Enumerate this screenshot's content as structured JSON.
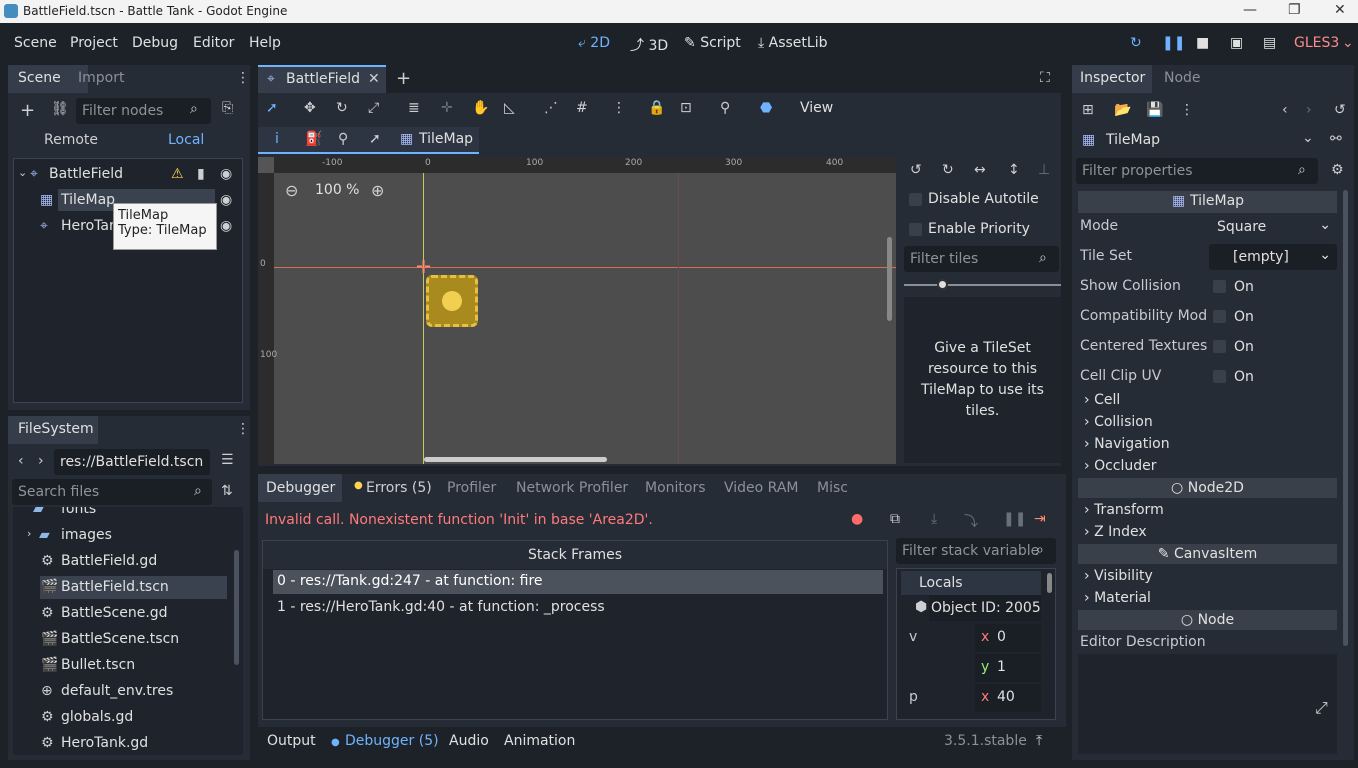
{
  "window": {
    "title": "BattleField.tscn - Battle Tank - Godot Engine",
    "controls": {
      "minimize": "—",
      "maximize": "❐",
      "close": "✕"
    }
  },
  "menu": {
    "items": [
      "Scene",
      "Project",
      "Debug",
      "Editor",
      "Help"
    ]
  },
  "workspaces": {
    "items": [
      "2D",
      "3D",
      "Script",
      "AssetLib"
    ],
    "active": "2D"
  },
  "run": {
    "renderer": "GLES3"
  },
  "scene_dock": {
    "tabs": [
      "Scene",
      "Import"
    ],
    "filter_placeholder": "Filter nodes",
    "remote": "Remote",
    "local": "Local",
    "tree": [
      {
        "name": "BattleField",
        "icon": "node2d-icon"
      },
      {
        "name": "TileMap",
        "icon": "tilemap-icon"
      },
      {
        "name": "HeroTank",
        "icon": "node2d-icon"
      }
    ],
    "tooltip": {
      "line1": "TileMap",
      "line2": "Type: TileMap"
    }
  },
  "filesystem": {
    "title": "FileSystem",
    "path": "res://BattleField.tscn",
    "search_placeholder": "Search files",
    "items": [
      {
        "name": "fonts",
        "icon": "folder-icon"
      },
      {
        "name": "images",
        "icon": "folder-icon"
      },
      {
        "name": "BattleField.gd",
        "icon": "gear-icon"
      },
      {
        "name": "BattleField.tscn",
        "icon": "scene-icon"
      },
      {
        "name": "BattleScene.gd",
        "icon": "gear-icon"
      },
      {
        "name": "BattleScene.tscn",
        "icon": "scene-icon"
      },
      {
        "name": "Bullet.tscn",
        "icon": "scene-icon"
      },
      {
        "name": "default_env.tres",
        "icon": "globe-icon"
      },
      {
        "name": "globals.gd",
        "icon": "gear-icon"
      },
      {
        "name": "HeroTank.gd",
        "icon": "gear-icon"
      }
    ],
    "selected": "BattleField.tscn"
  },
  "editor": {
    "tab": "BattleField",
    "view_label": "View",
    "tilemap_label": "TileMap",
    "zoom": "100 %",
    "ruler_h": [
      "-100",
      "0",
      "100",
      "200",
      "300",
      "400"
    ],
    "ruler_v": [
      "0",
      "100"
    ]
  },
  "tile_panel": {
    "disable_autotile": "Disable Autotile",
    "enable_priority": "Enable Priority",
    "filter_placeholder": "Filter tiles",
    "message": "Give a TileSet resource to this TileMap to use its tiles."
  },
  "debugger": {
    "tabs": [
      "Debugger",
      "Errors (5)",
      "Profiler",
      "Network Profiler",
      "Monitors",
      "Video RAM",
      "Misc"
    ],
    "error": "Invalid call. Nonexistent function 'Init' in base 'Area2D'.",
    "stack_header": "Stack Frames",
    "frames": [
      "0 - res://Tank.gd:247 - at function: fire",
      "1 - res://HeroTank.gd:40 - at function: _process"
    ],
    "filter_placeholder": "Filter stack variable",
    "locals": "Locals",
    "object_id": "Object ID: 2005",
    "vars": [
      {
        "name": "v",
        "x": "0",
        "y": "1"
      },
      {
        "name": "p",
        "x": "40"
      }
    ]
  },
  "bottom": {
    "tabs": [
      "Output",
      "Debugger (5)",
      "Audio",
      "Animation"
    ],
    "version": "3.5.1.stable"
  },
  "inspector": {
    "tabs": [
      "Inspector",
      "Node"
    ],
    "node_type": "TileMap",
    "filter_placeholder": "Filter properties",
    "section": "TileMap",
    "props": [
      {
        "key": "Mode",
        "value": "Square"
      },
      {
        "key": "Tile Set",
        "value": "[empty]"
      },
      {
        "key": "Show Collision",
        "value": "On"
      },
      {
        "key": "Compatibility Mod",
        "value": "On"
      },
      {
        "key": "Centered Textures",
        "value": "On"
      },
      {
        "key": "Cell Clip UV",
        "value": "On"
      }
    ],
    "groups1": [
      "Cell",
      "Collision",
      "Navigation",
      "Occluder"
    ],
    "node2d": "Node2D",
    "groups2": [
      "Transform",
      "Z Index"
    ],
    "canvasitem": "CanvasItem",
    "groups3": [
      "Visibility",
      "Material"
    ],
    "node": "Node",
    "editor_description": "Editor Description"
  },
  "colors": {
    "accent": "#6fb3ff",
    "error": "#ff7a7a",
    "warning": "#ffd54f",
    "base": "#262c36"
  }
}
